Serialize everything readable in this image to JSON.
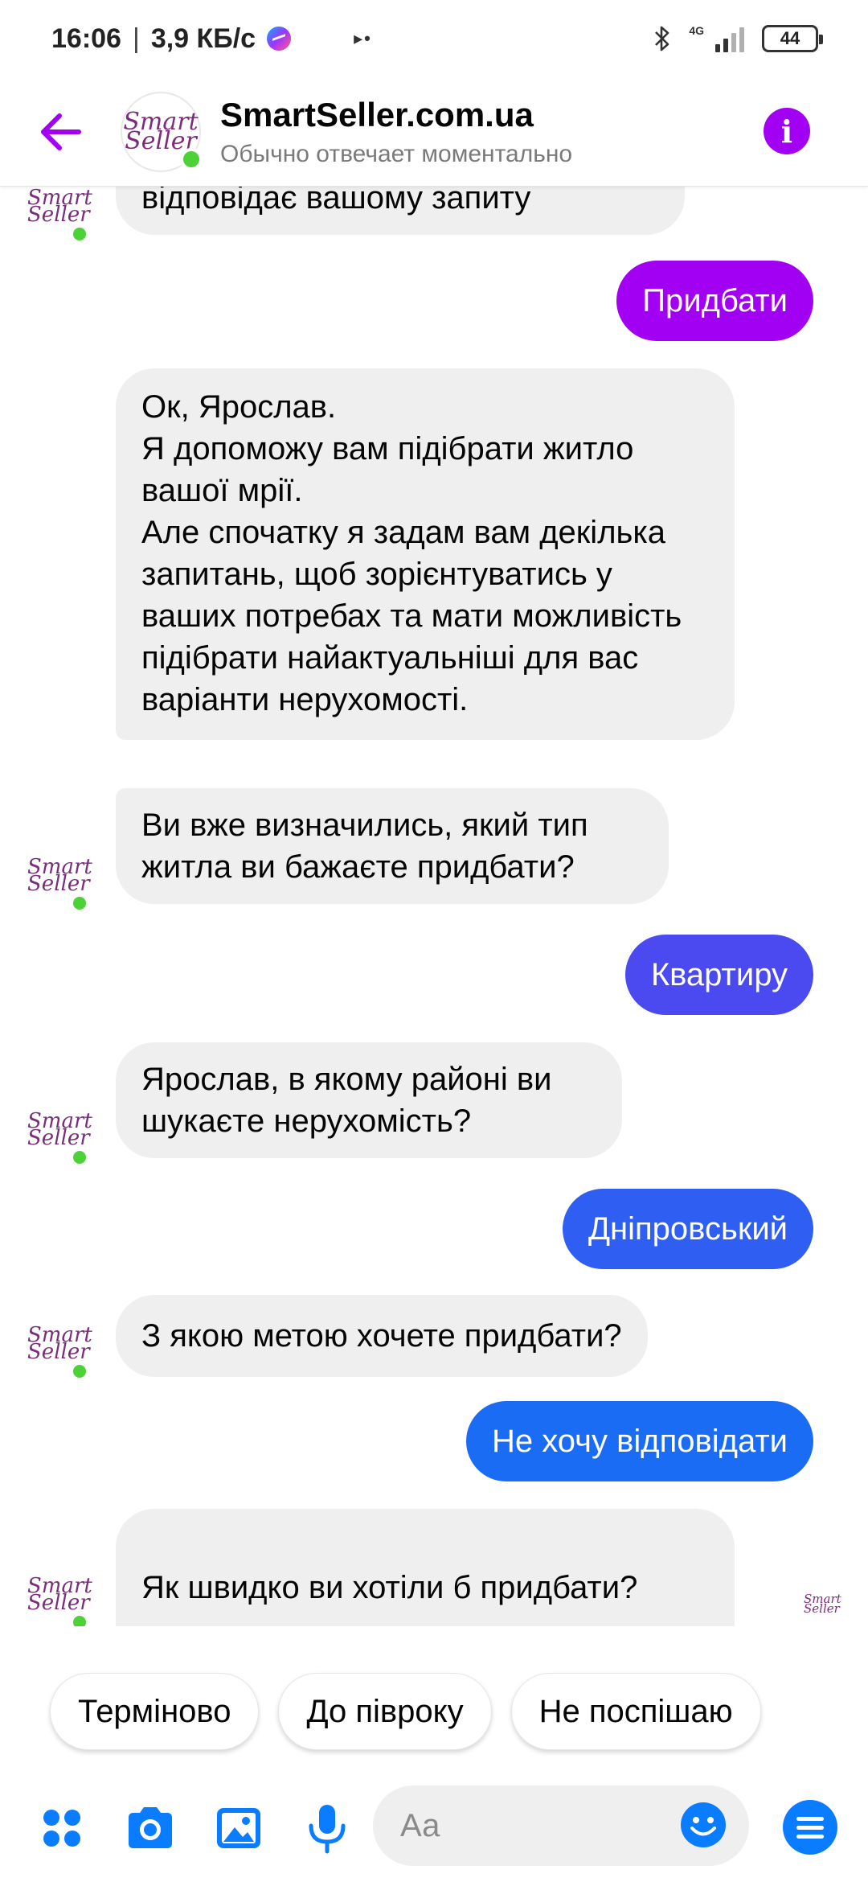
{
  "status_bar": {
    "time": "16:06",
    "speed": "3,9 КБ/с",
    "network": "4G",
    "battery": "44"
  },
  "header": {
    "name": "SmartSeller.com.ua",
    "subtitle": "Обычно отвечает моментально",
    "logo_line1": "Smart",
    "logo_line2": "Seller"
  },
  "colors": {
    "accent": "#a100f2",
    "bubble_in": "#efefef",
    "out_1": "#a100f2",
    "out_2": "#4a4af0",
    "out_3": "#2f5ff2",
    "out_4": "#1a6cf5",
    "online": "#4cd137",
    "composer_blue": "#0a7cff"
  },
  "messages": {
    "m0": "відповідає вашому запиту",
    "m1": "Придбати",
    "m2": "Ок, Ярослав.\nЯ допоможу вам підібрати житло вашої мрії.\nАле спочатку я задам вам декілька запитань, щоб зорієнтуватись у ваших потребах та мати можливість підібрати найактуальніші для вас варіанти нерухомості.",
    "m3": "Ви вже визначились, який тип житла ви бажаєте придбати?",
    "m4": "Квартиру",
    "m5": "Ярослав, в якому районі ви шукаєте нерухомість?",
    "m6": "Дніпровський",
    "m7": "З якою метою хочете придбати?",
    "m8": "Не хочу відповідати",
    "m9": "Як швидко ви хотіли б придбати?",
    "m9_emoji": "🔑🌳🏠"
  },
  "quick_replies": [
    "Терміново",
    "До півроку",
    "Не поспішаю"
  ],
  "composer": {
    "placeholder": "Аа",
    "icons": [
      "apps-icon",
      "camera-icon",
      "gallery-icon",
      "microphone-icon",
      "emoji-icon",
      "menu-icon"
    ]
  }
}
